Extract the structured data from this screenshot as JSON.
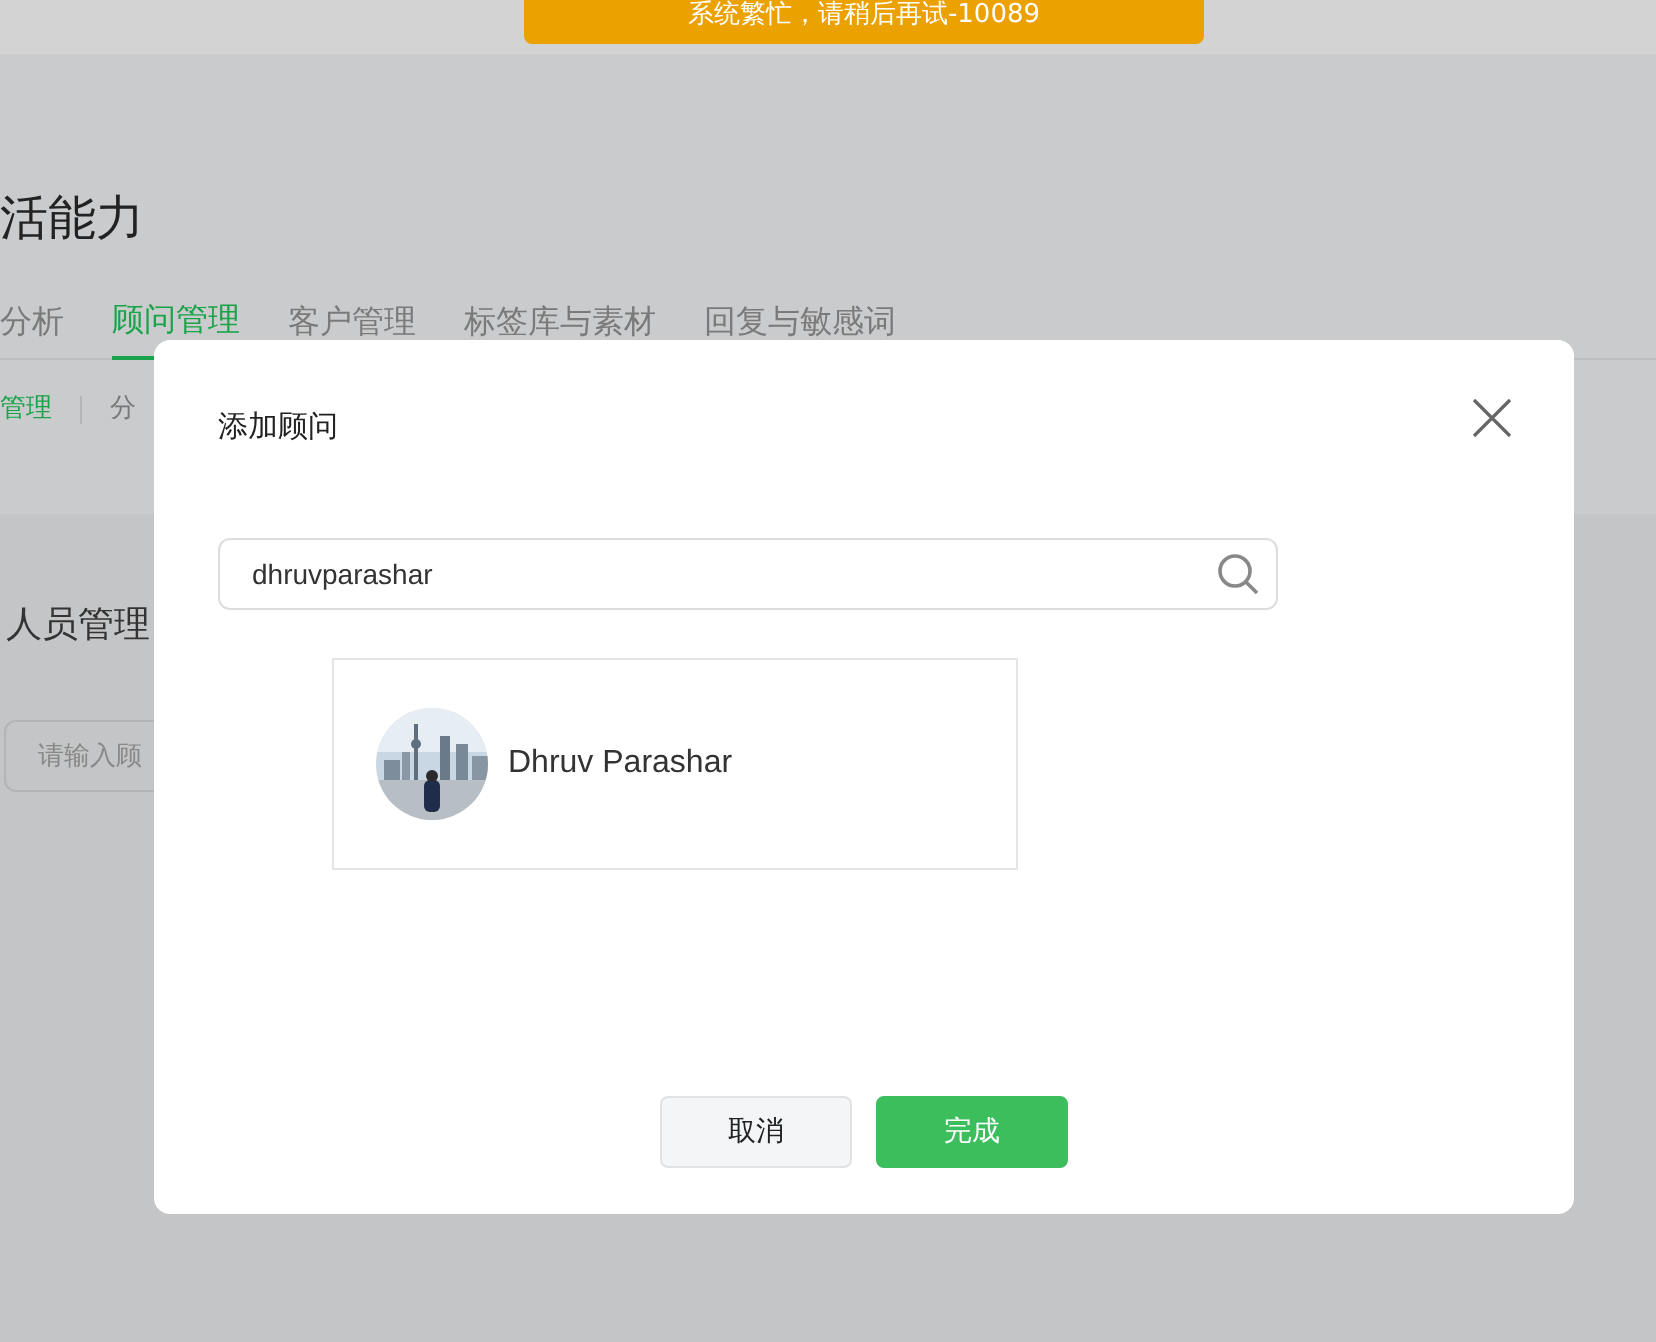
{
  "toast": {
    "text": "系统繁忙，请稍后再试-10089"
  },
  "page": {
    "title": "活能力",
    "tabs": [
      {
        "label": "分析",
        "selected": false
      },
      {
        "label": "顾问管理",
        "selected": true
      },
      {
        "label": "客户管理",
        "selected": false
      },
      {
        "label": "标签库与素材",
        "selected": false
      },
      {
        "label": "回复与敏感词",
        "selected": false
      }
    ],
    "subtabs": [
      {
        "label": "管理",
        "selected": true
      },
      {
        "label": "分",
        "selected": false
      }
    ],
    "section_title": "人员管理",
    "search": {
      "placeholder": "请输入顾"
    }
  },
  "dialog": {
    "title": "添加顾问",
    "search": {
      "value": "dhruvparashar"
    },
    "results": [
      {
        "name": "Dhruv Parashar"
      }
    ],
    "buttons": [
      {
        "label": "取消",
        "kind": "secondary"
      },
      {
        "label": "完成",
        "kind": "primary"
      }
    ]
  }
}
